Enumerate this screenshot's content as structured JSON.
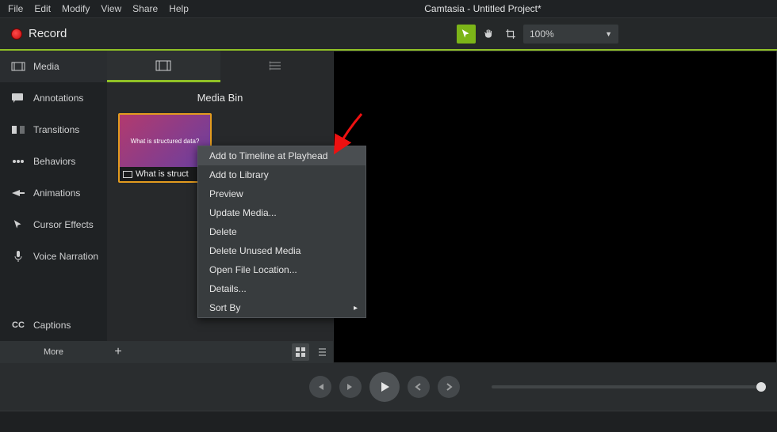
{
  "app": {
    "title": "Camtasia - Untitled Project*"
  },
  "menu": [
    "File",
    "Edit",
    "Modify",
    "View",
    "Share",
    "Help"
  ],
  "record_label": "Record",
  "zoom": {
    "value": "100%"
  },
  "sidebar": {
    "items": [
      {
        "label": "Media"
      },
      {
        "label": "Annotations"
      },
      {
        "label": "Transitions"
      },
      {
        "label": "Behaviors"
      },
      {
        "label": "Animations"
      },
      {
        "label": "Cursor Effects"
      },
      {
        "label": "Voice Narration"
      },
      {
        "label": "Captions"
      }
    ],
    "more": "More"
  },
  "bin": {
    "title": "Media Bin",
    "clip": {
      "label": "What is struct",
      "imgtext": "What is structured data?"
    }
  },
  "context_menu": [
    "Add to Timeline at Playhead",
    "Add to Library",
    "Preview",
    "Update Media...",
    "Delete",
    "Delete Unused Media",
    "Open File Location...",
    "Details...",
    "Sort By"
  ]
}
